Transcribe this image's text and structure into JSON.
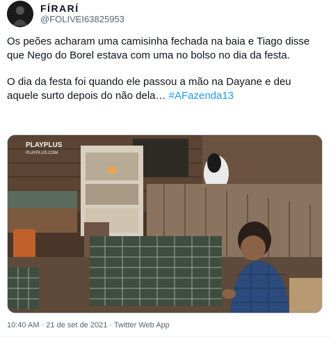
{
  "user": {
    "display_name": "FÍRARÍ",
    "handle": "@FOLIVEI63825953"
  },
  "tweet": {
    "paragraph1": "Os peões acharam uma camisinha fechada na baia e Tiago disse que Nego do Borel estava com uma no bolso no dia da festa.",
    "paragraph2_text": "O dia da festa foi quando ele passou a mão na Dayane e deu aquele surto depois do não dela… ",
    "hashtag": "#AFazenda13"
  },
  "media": {
    "watermark": "PLAYPLUS",
    "watermark_sub": "PLAYPLUS.COM"
  },
  "meta": {
    "timestamp": "10:40 AM · 21 de set de 2021 · Twitter Web App"
  }
}
